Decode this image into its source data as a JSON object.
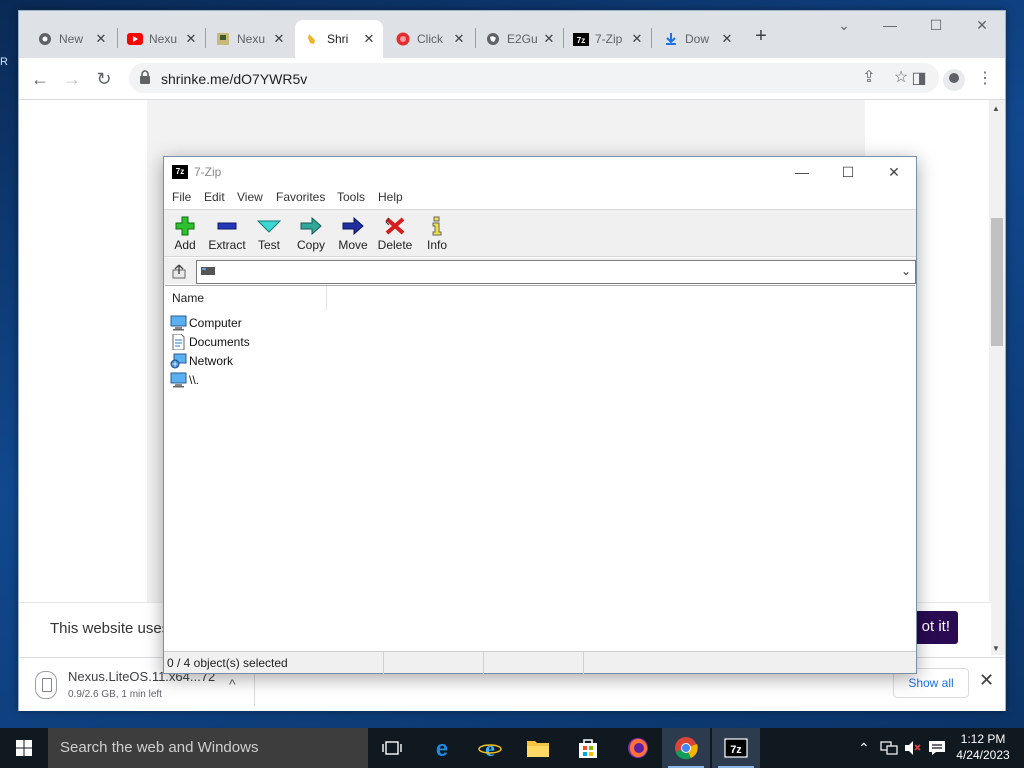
{
  "browser": {
    "tabs": [
      {
        "label": "New",
        "icon": "chrome-icon"
      },
      {
        "label": "Nexu",
        "icon": "youtube-icon"
      },
      {
        "label": "Nexu",
        "icon": "nexus-icon"
      },
      {
        "label": "Shri",
        "icon": "hand-icon"
      },
      {
        "label": "Click",
        "icon": "red-circle-icon"
      },
      {
        "label": "E2Gu",
        "icon": "globe-icon"
      },
      {
        "label": "7-Zip",
        "icon": "7zip-icon"
      },
      {
        "label": "Dow",
        "icon": "download-icon"
      }
    ],
    "url": "shrinke.me/dO7YWR5v",
    "cookie_text": "This website uses",
    "cookie_button": "ot it!",
    "download": {
      "name": "Nexus.LiteOS.11.x64...72",
      "status": "0.9/2.6 GB, 1 min left"
    },
    "show_all": "Show all"
  },
  "zip": {
    "title": "7-Zip",
    "menu": [
      "File",
      "Edit",
      "View",
      "Favorites",
      "Tools",
      "Help"
    ],
    "toolbar": [
      "Add",
      "Extract",
      "Test",
      "Copy",
      "Move",
      "Delete",
      "Info"
    ],
    "column_name": "Name",
    "items": [
      {
        "name": "Computer",
        "icon": "computer-icon"
      },
      {
        "name": "Documents",
        "icon": "document-icon"
      },
      {
        "name": "Network",
        "icon": "network-icon"
      },
      {
        "name": "\\\\.",
        "icon": "computer-icon"
      }
    ],
    "status": "0 / 4 object(s) selected"
  },
  "taskbar": {
    "search_placeholder": "Search the web and Windows",
    "time": "1:12 PM",
    "date": "4/24/2023"
  }
}
